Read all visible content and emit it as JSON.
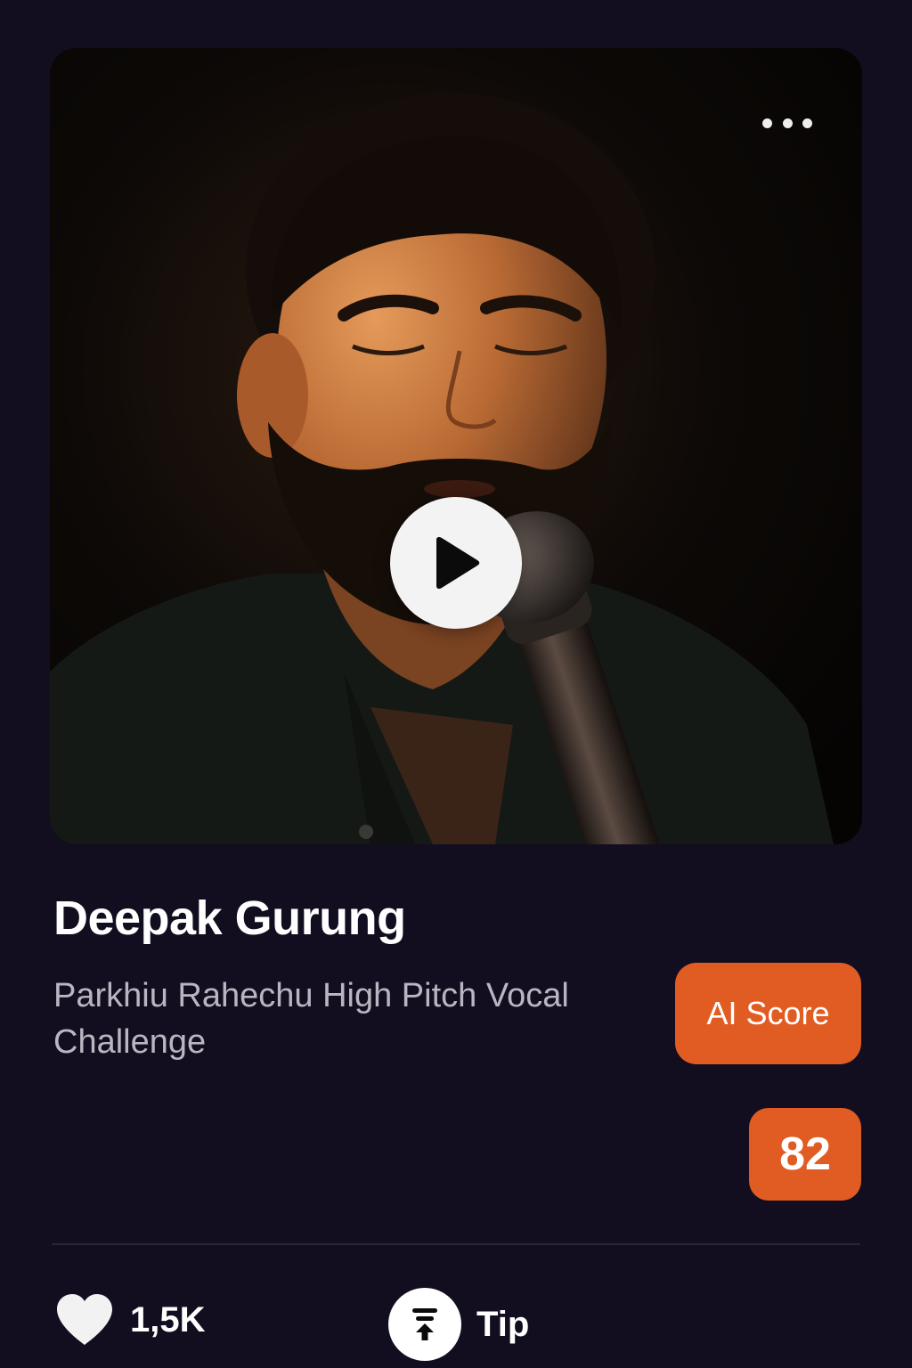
{
  "performer": {
    "name": "Deepak Gurung"
  },
  "challenge": {
    "title": "Parkhiu Rahechu High Pitch Vocal Challenge"
  },
  "ai_score": {
    "button_label": "AI Score",
    "value": "82"
  },
  "actions": {
    "likes": "1,5K",
    "tip_label": "Tip"
  },
  "icons": {
    "more": "more-horizontal-icon",
    "play": "play-icon",
    "like": "heart-icon",
    "tip": "tip-upload-icon"
  },
  "colors": {
    "background": "#120e1f",
    "accent": "#e15c23",
    "subtitle": "#b9b6c1"
  }
}
